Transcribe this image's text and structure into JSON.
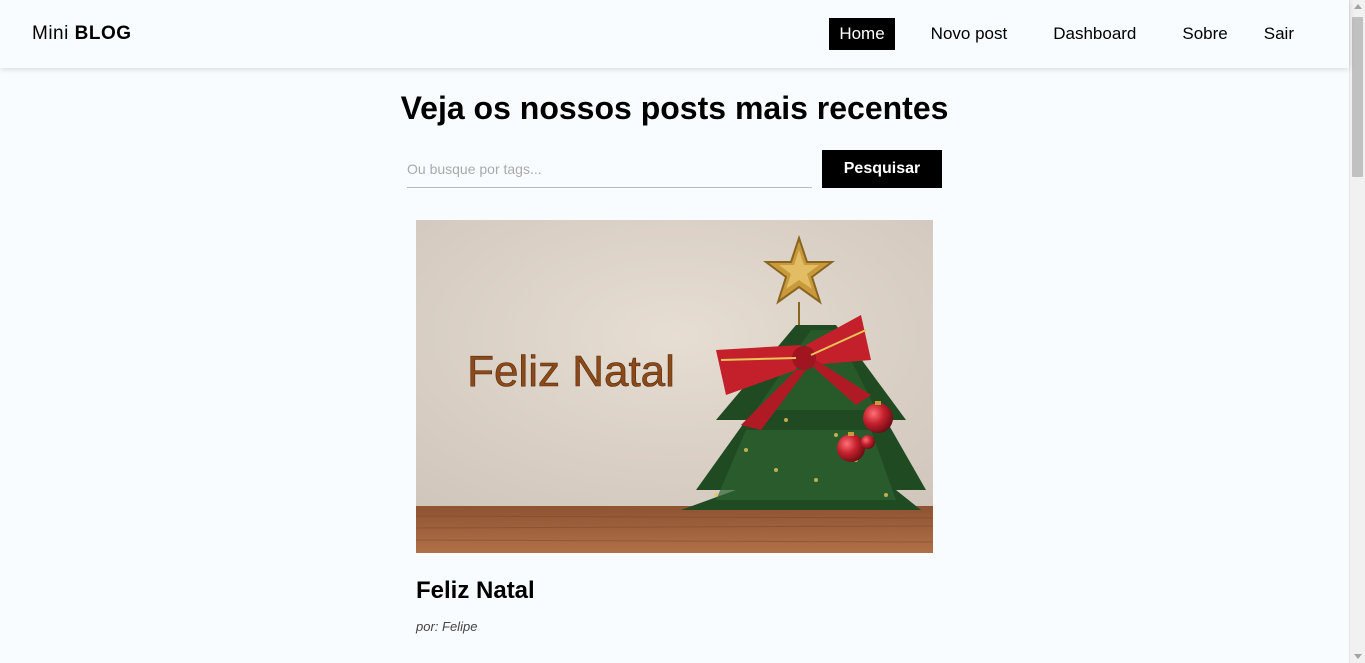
{
  "navbar": {
    "brand_prefix": "Mini",
    "brand_name": "BLOG",
    "links": [
      {
        "label": "Home",
        "active": true
      },
      {
        "label": "Novo post",
        "active": false
      },
      {
        "label": "Dashboard",
        "active": false
      },
      {
        "label": "Sobre",
        "active": false
      }
    ],
    "logout_label": "Sair"
  },
  "home": {
    "title": "Veja os nossos posts mais recentes",
    "search": {
      "placeholder": "Ou busque por tags...",
      "button_label": "Pesquisar"
    }
  },
  "posts": [
    {
      "image_alt": "Feliz Natal",
      "image_text": "Feliz Natal",
      "title": "Feliz Natal",
      "author": "por: Felipe"
    }
  ],
  "colors": {
    "background": "#f8fcff",
    "accent": "#000000",
    "image_wall": "#ddd3c9",
    "image_floor": "#a0603a",
    "tree_green": "#1f4a22",
    "ribbon_red": "#c4202c",
    "star_gold": "#c89a3c"
  }
}
